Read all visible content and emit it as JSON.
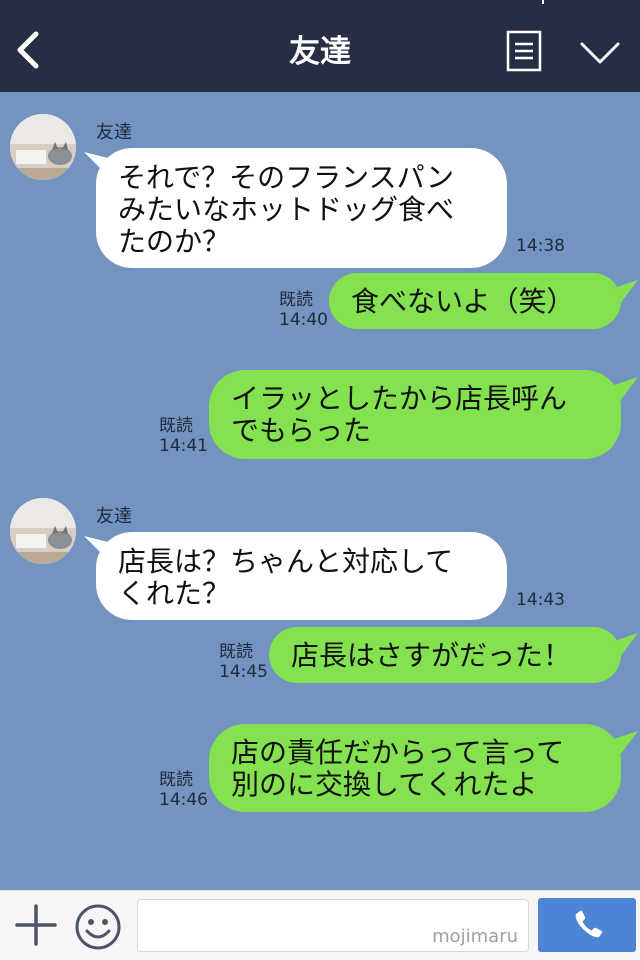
{
  "header": {
    "title": "友達"
  },
  "messages": [
    {
      "sender": "友達",
      "line1": "それで？そのフランスパン",
      "line2": "みたいなホットドッグ食べ",
      "line3": "たのか？",
      "time": "14:38"
    },
    {
      "read": "既読",
      "time": "14:40",
      "text": "食べないよ（笑）"
    },
    {
      "read": "既読",
      "time": "14:41",
      "line1": "イラッとしたから店長呼ん",
      "line2": "でもらった"
    },
    {
      "sender": "友達",
      "line1": "店長は？ちゃんと対応して",
      "line2": "くれた？",
      "time": "14:43"
    },
    {
      "read": "既読",
      "time": "14:45",
      "text": "店長はさすがだった！"
    },
    {
      "read": "既読",
      "time": "14:46",
      "line1": "店の責任だからって言って",
      "line2": "別のに交換してくれたよ"
    }
  ],
  "footer": {
    "watermark": "mojimaru"
  },
  "colors": {
    "header_bg": "#252e43",
    "chat_bg": "#7393c0",
    "incoming_bubble": "#ffffff",
    "outgoing_bubble": "#84e14f",
    "send_button": "#4d84d6"
  },
  "icons": {
    "back": "chevron-left-icon",
    "menu": "notes-menu-icon",
    "more": "chevron-down-icon",
    "plus": "plus-icon",
    "emoji": "smiley-icon",
    "call": "phone-icon"
  }
}
